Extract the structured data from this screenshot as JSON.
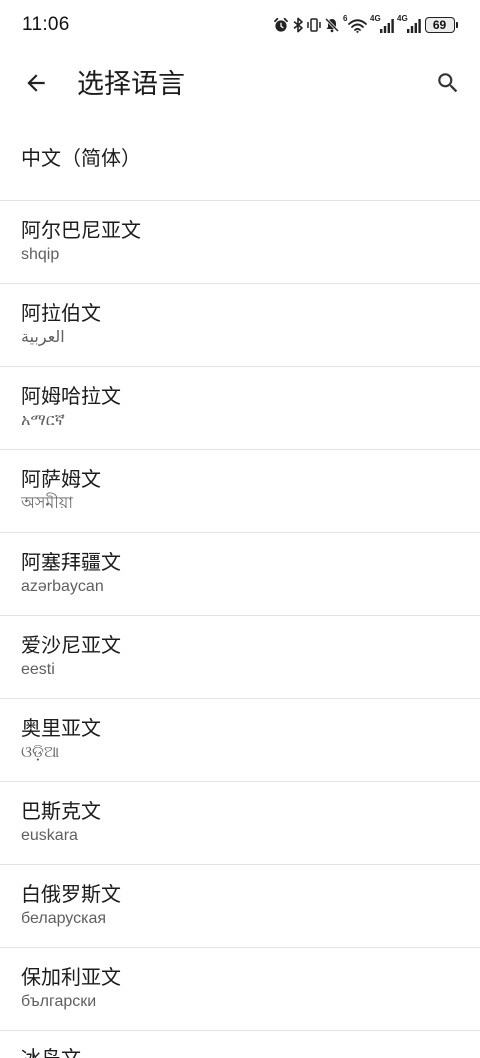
{
  "status_bar": {
    "time": "11:06",
    "icons": [
      "alarm-icon",
      "bluetooth-icon",
      "vibrate-icon",
      "mute-icon",
      "wifi-icon",
      "signal-icon",
      "signal-icon",
      "battery-icon"
    ],
    "wifi_badge": "6",
    "sim1_network": "4G",
    "sim2_network": "4G",
    "battery_percent": "69"
  },
  "header": {
    "back_icon": "arrow-back-icon",
    "title": "选择语言",
    "search_icon": "search-icon"
  },
  "languages": [
    {
      "name": "中文（简体）"
    },
    {
      "name": "阿尔巴尼亚文",
      "native": "shqip"
    },
    {
      "name": "阿拉伯文",
      "native": "العربية"
    },
    {
      "name": "阿姆哈拉文",
      "native": "አማርኛ"
    },
    {
      "name": "阿萨姆文",
      "native": "অসমীয়া"
    },
    {
      "name": "阿塞拜疆文",
      "native": "azərbaycan"
    },
    {
      "name": "爱沙尼亚文",
      "native": "eesti"
    },
    {
      "name": "奥里亚文",
      "native": "ଓଡ଼ିଆ"
    },
    {
      "name": "巴斯克文",
      "native": "euskara"
    },
    {
      "name": "白俄罗斯文",
      "native": "беларуская"
    },
    {
      "name": "保加利亚文",
      "native": "български"
    },
    {
      "name": "冰岛文"
    }
  ],
  "colors": {
    "background": "#ffffff",
    "text_primary": "#1c1c1c",
    "text_secondary": "#5f5f5f",
    "divider": "#e3e3e3"
  }
}
